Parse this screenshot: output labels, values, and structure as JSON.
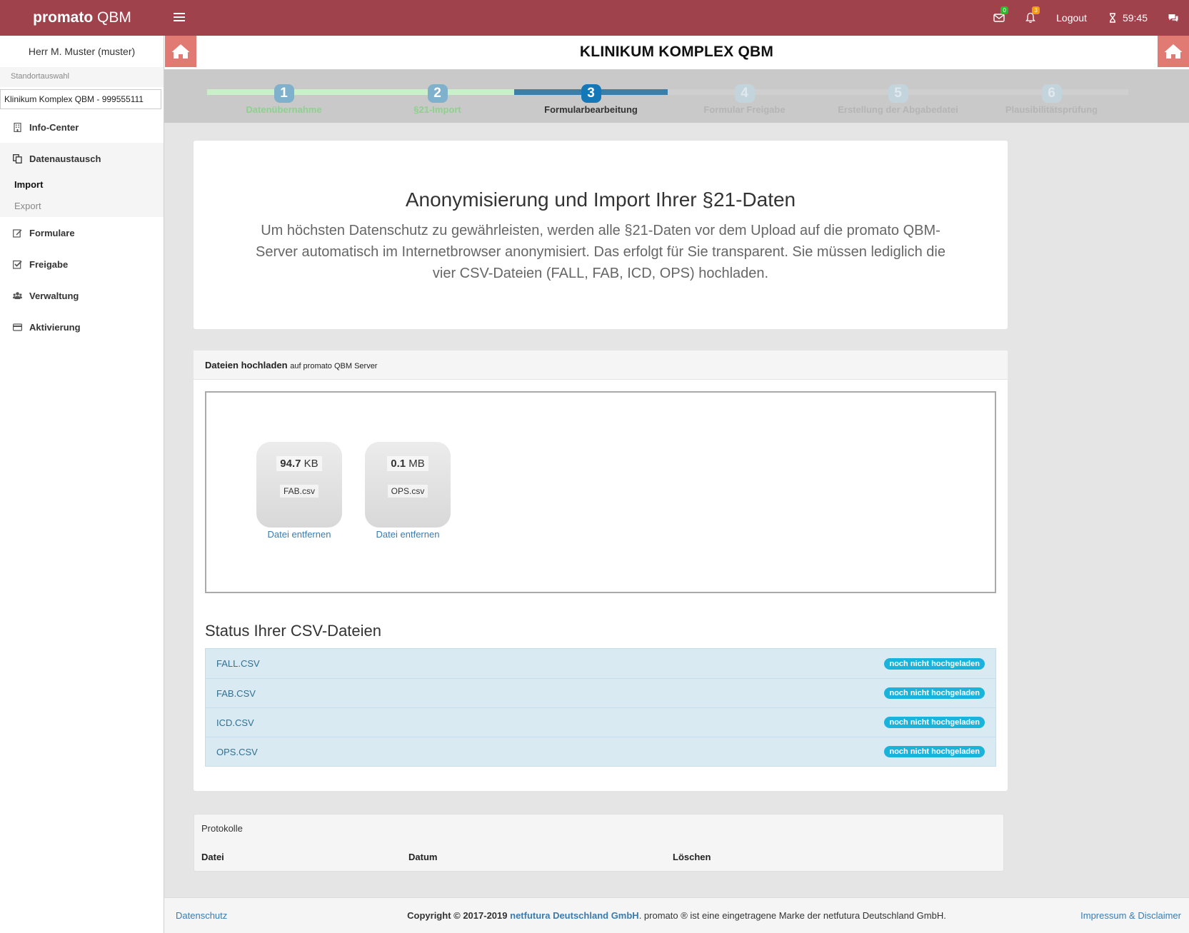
{
  "app": {
    "brand_bold": "promato",
    "brand_rest": "QBM"
  },
  "topbar": {
    "mail_badge": "0",
    "bell_badge": "3",
    "logout": "Logout",
    "timer": "59:45"
  },
  "sidebar": {
    "user": "Herr M. Muster (muster)",
    "standort_label": "Standortauswahl",
    "standort_value": "Klinikum Komplex QBM - 999555111",
    "items": [
      {
        "label": "Info-Center",
        "icon": "building-icon"
      },
      {
        "label": "Datenaustausch",
        "icon": "copy-icon"
      },
      {
        "label": "Formulare",
        "icon": "edit-icon"
      },
      {
        "label": "Freigabe",
        "icon": "check-square-icon"
      },
      {
        "label": "Verwaltung",
        "icon": "users-icon"
      },
      {
        "label": "Aktivierung",
        "icon": "credit-card-icon"
      }
    ],
    "sub_items": [
      {
        "label": "Import"
      },
      {
        "label": "Export"
      }
    ]
  },
  "header": {
    "title": "KLINIKUM KOMPLEX QBM"
  },
  "wizard": {
    "steps": [
      {
        "num": "1",
        "label": "Datenübernahme",
        "state": "done"
      },
      {
        "num": "2",
        "label": "§21-Import",
        "state": "done"
      },
      {
        "num": "3",
        "label": "Formularbearbeitung",
        "state": "current"
      },
      {
        "num": "4",
        "label": "Formular Freigabe",
        "state": "todo"
      },
      {
        "num": "5",
        "label": "Erstellung der Abgabedatei",
        "state": "todo"
      },
      {
        "num": "6",
        "label": "Plausibilitätsprüfung",
        "state": "todo"
      }
    ]
  },
  "intro": {
    "title": "Anonymisierung und Import Ihrer §21-Daten",
    "text": "Um höchsten Datenschutz zu gewährleisten, werden alle §21-Daten vor dem Upload auf die promato QBM-Server automatisch im Internetbrowser anonymisiert. Das erfolgt für Sie transparent. Sie müssen lediglich die vier CSV-Dateien (FALL, FAB, ICD, OPS) hochladen."
  },
  "upload": {
    "title": "Dateien hochladen",
    "subtitle": "auf promato QBM Server",
    "files": [
      {
        "size_value": "94.7",
        "size_unit": "KB",
        "name": "FAB.csv",
        "remove": "Datei entfernen"
      },
      {
        "size_value": "0.1",
        "size_unit": "MB",
        "name": "OPS.csv",
        "remove": "Datei entfernen"
      }
    ]
  },
  "status": {
    "title": "Status Ihrer CSV-Dateien",
    "rows": [
      {
        "name": "FALL.CSV",
        "label": "noch nicht hochgeladen"
      },
      {
        "name": "FAB.CSV",
        "label": "noch nicht hochgeladen"
      },
      {
        "name": "ICD.CSV",
        "label": "noch nicht hochgeladen"
      },
      {
        "name": "OPS.CSV",
        "label": "noch nicht hochgeladen"
      }
    ]
  },
  "protokolle": {
    "title": "Protokolle",
    "columns": [
      "Datei",
      "Datum",
      "Löschen"
    ]
  },
  "footer": {
    "left": "Datenschutz",
    "copyright": "Copyright © 2017-2019",
    "company": "netfutura Deutschland GmbH",
    "rest": ". promato ® ist eine eingetragene Marke der netfutura Deutschland GmbH.",
    "right": "Impressum & Disclaimer"
  },
  "colors": {
    "topbar": "#a0424b",
    "home_button": "#e07a72",
    "active_step": "#1477b8",
    "label_info": "#1ab3dc"
  }
}
